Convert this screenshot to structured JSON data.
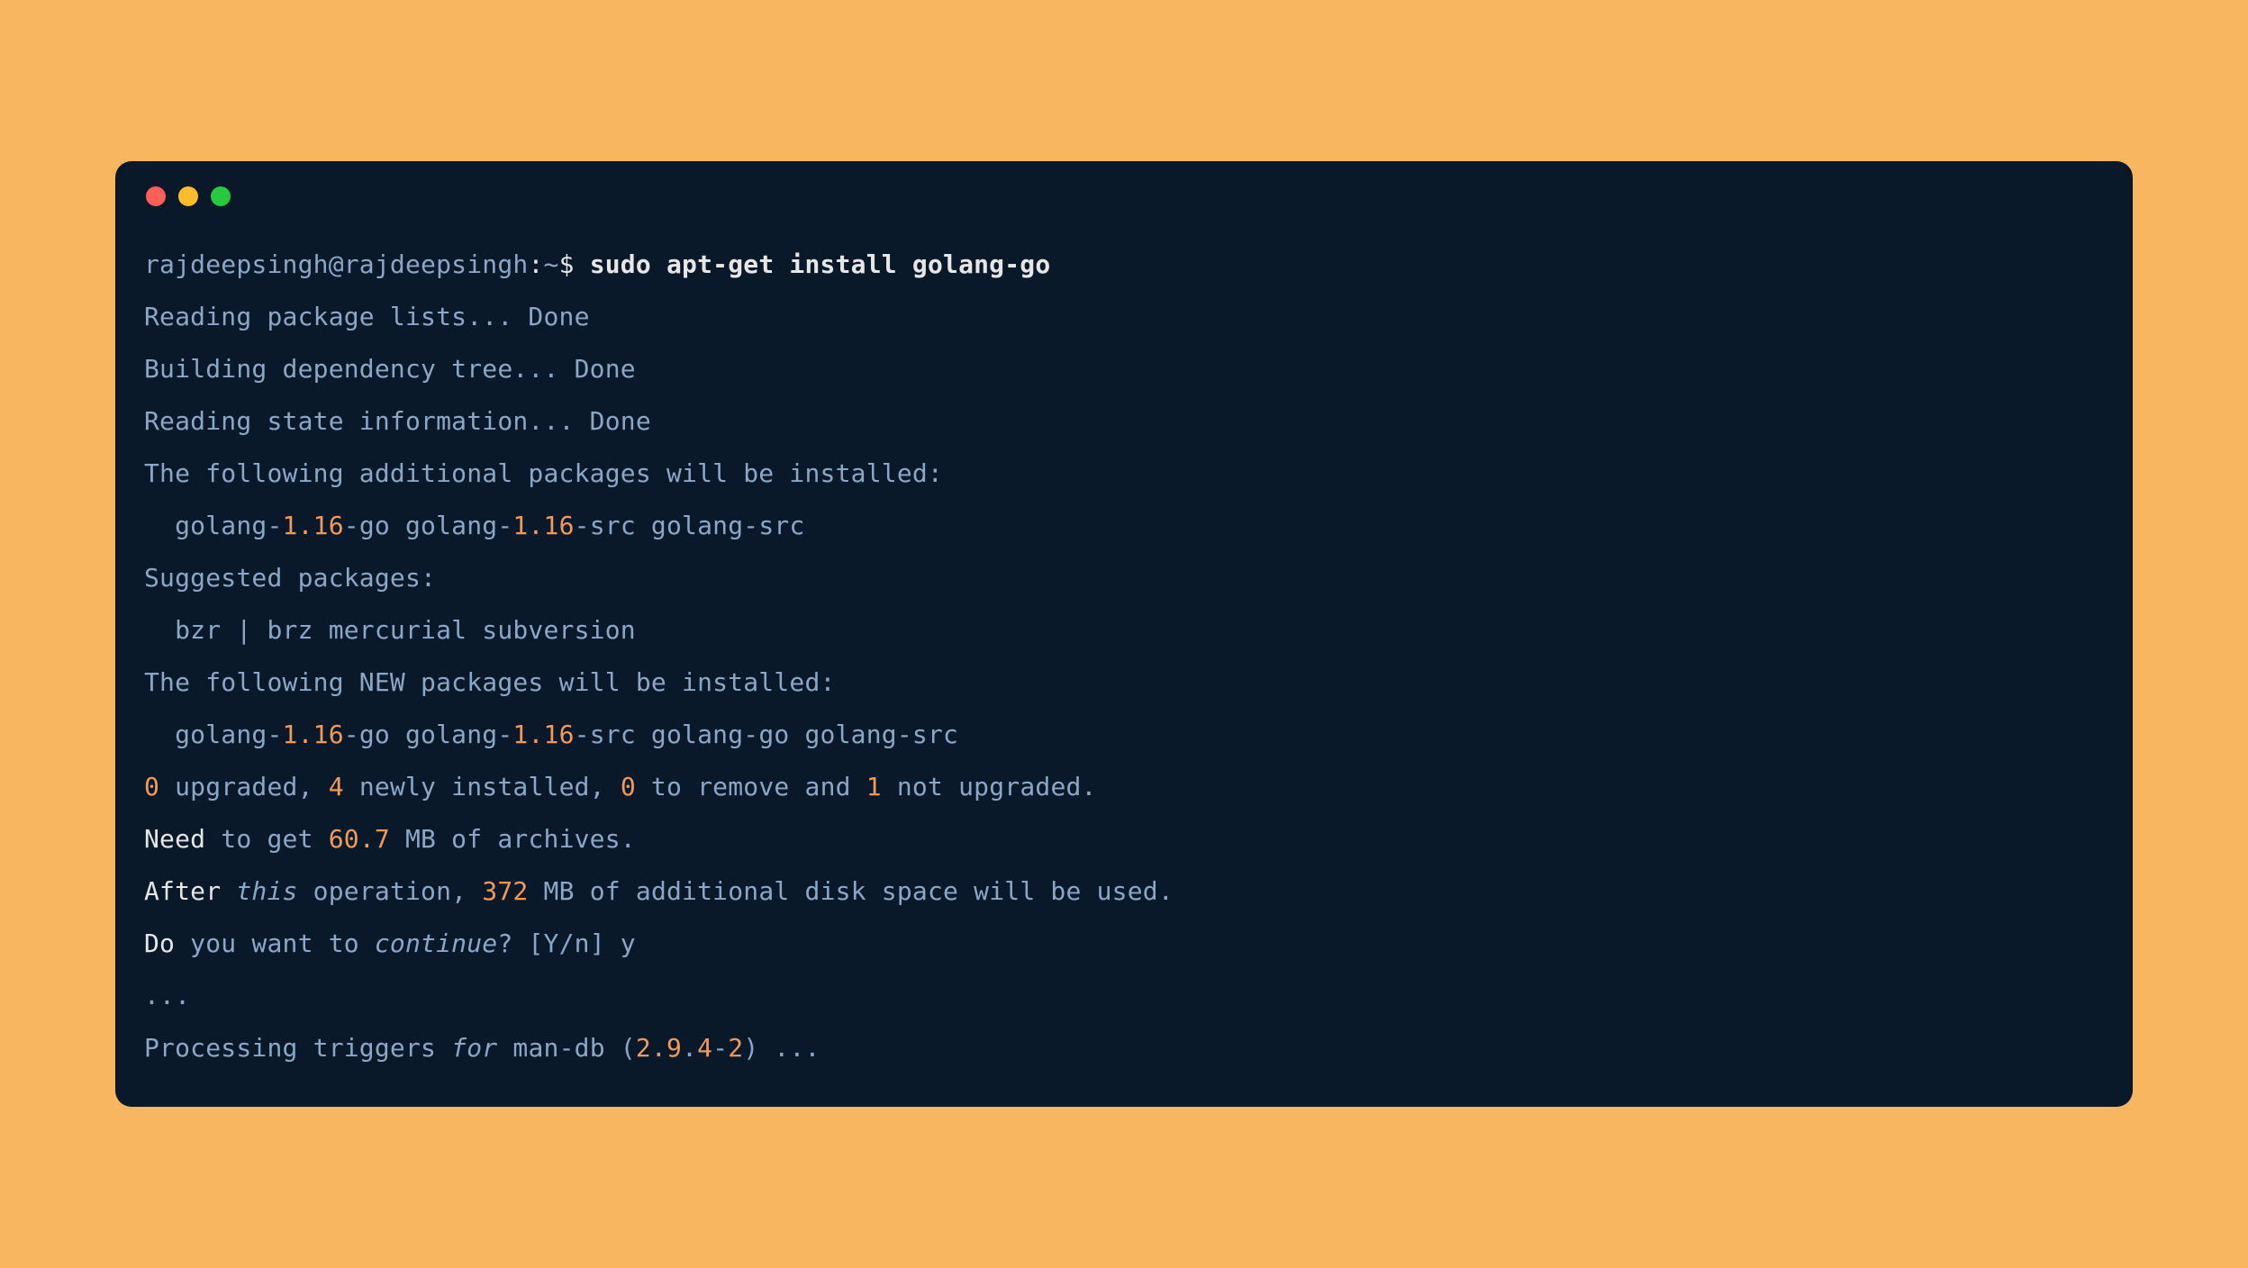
{
  "prompt": {
    "user_host": "rajdeepsingh@rajdeepsingh",
    "colon": ":",
    "path": "~",
    "dollar": "$",
    "command": "sudo apt-get install golang-go"
  },
  "lines": {
    "l1": "Reading package lists... Done",
    "l2": "Building dependency tree... Done",
    "l3": "Reading state information... Done",
    "l4": "The following additional packages will be installed:",
    "l5a": "  golang-",
    "l5b": "1.16",
    "l5c": "-go golang-",
    "l5d": "1.16",
    "l5e": "-src golang-src",
    "l6": "Suggested packages:",
    "l7": "  bzr | brz mercurial subversion",
    "l8": "The following NEW packages will be installed:",
    "l9a": "  golang-",
    "l9b": "1.16",
    "l9c": "-go golang-",
    "l9d": "1.16",
    "l9e": "-src golang-go golang-src",
    "l10a": "0",
    "l10b": " upgraded, ",
    "l10c": "4",
    "l10d": " newly installed, ",
    "l10e": "0",
    "l10f": " to remove and ",
    "l10g": "1",
    "l10h": " not upgraded.",
    "l11a": "Need",
    "l11b": " to get ",
    "l11c": "60.7",
    "l11d": " MB of archives.",
    "l12a": "After",
    "l12b": " ",
    "l12c": "this",
    "l12d": " operation, ",
    "l12e": "372",
    "l12f": " MB of additional disk space will be used.",
    "l13a": "Do",
    "l13b": " you want to ",
    "l13c": "continue",
    "l13d": "? [Y/n] y",
    "l14": "...",
    "l15a": "Processing triggers ",
    "l15b": "for",
    "l15c": " man-db (",
    "l15d": "2.9",
    "l15e": ".",
    "l15f": "4",
    "l15g": "-",
    "l15h": "2",
    "l15i": ") ..."
  }
}
